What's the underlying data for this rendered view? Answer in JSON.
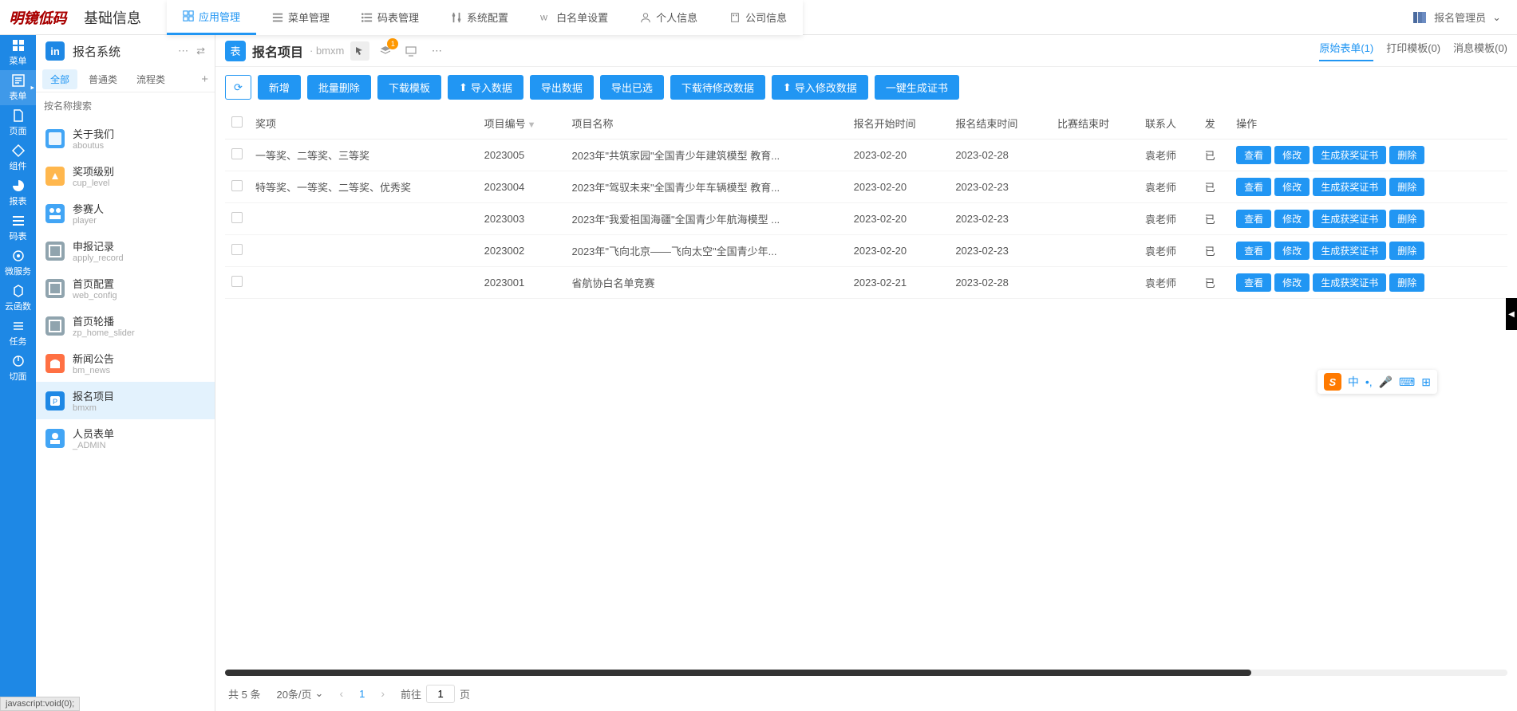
{
  "brand_logo": "明镜低码",
  "brand_title": "基础信息",
  "top_tabs": [
    {
      "label": "应用管理",
      "active": true
    },
    {
      "label": "菜单管理",
      "active": false
    },
    {
      "label": "码表管理",
      "active": false
    },
    {
      "label": "系统配置",
      "active": false
    },
    {
      "label": "白名单设置",
      "active": false
    },
    {
      "label": "个人信息",
      "active": false
    },
    {
      "label": "公司信息",
      "active": false
    }
  ],
  "user_name": "报名管理员",
  "rail": [
    {
      "label": "菜单"
    },
    {
      "label": "表单",
      "active": true
    },
    {
      "label": "页面"
    },
    {
      "label": "组件"
    },
    {
      "label": "报表"
    },
    {
      "label": "码表"
    },
    {
      "label": "微服务"
    },
    {
      "label": "云函数"
    },
    {
      "label": "任务"
    },
    {
      "label": "切面"
    }
  ],
  "app": {
    "badge": "in",
    "name": "报名系统"
  },
  "tree_tabs": [
    {
      "label": "全部",
      "active": true
    },
    {
      "label": "普通类"
    },
    {
      "label": "流程类"
    }
  ],
  "tree_search_placeholder": "按名称搜索",
  "tree_items": [
    {
      "title": "关于我们",
      "sub": "aboutus",
      "color": "#42a5f5"
    },
    {
      "title": "奖项级别",
      "sub": "cup_level",
      "color": "#ffb74d"
    },
    {
      "title": "参赛人",
      "sub": "player",
      "color": "#42a5f5"
    },
    {
      "title": "申报记录",
      "sub": "apply_record",
      "color": "#90a4ae"
    },
    {
      "title": "首页配置",
      "sub": "web_config",
      "color": "#90a4ae"
    },
    {
      "title": "首页轮播",
      "sub": "zp_home_slider",
      "color": "#90a4ae"
    },
    {
      "title": "新闻公告",
      "sub": "bm_news",
      "color": "#ff7043"
    },
    {
      "title": "报名项目",
      "sub": "bmxm",
      "color": "#1e88e5",
      "selected": true
    },
    {
      "title": "人员表单",
      "sub": "_ADMIN",
      "color": "#42a5f5"
    }
  ],
  "content_header": {
    "badge": "表",
    "title": "报名项目",
    "code": "· bmxm",
    "layer_badge": "1",
    "right_tabs": [
      {
        "label": "原始表单(1)",
        "active": true
      },
      {
        "label": "打印模板(0)"
      },
      {
        "label": "消息模板(0)"
      }
    ]
  },
  "toolbar": {
    "refresh": "↻",
    "create": "新增",
    "batch_delete": "批量删除",
    "download_tpl": "下载模板",
    "import": "导入数据",
    "export": "导出数据",
    "export_sel": "导出已选",
    "download_mod": "下载待修改数据",
    "import_mod": "导入修改数据",
    "gen_cert": "一键生成证书"
  },
  "columns": [
    "奖项",
    "项目编号",
    "项目名称",
    "报名开始时间",
    "报名结束时间",
    "比赛结束时",
    "联系人",
    "发",
    "操作"
  ],
  "row_buttons": {
    "view": "查看",
    "edit": "修改",
    "gen": "生成获奖证书",
    "del": "删除"
  },
  "rows": [
    {
      "award": "一等奖、二等奖、三等奖",
      "code": "2023005",
      "name": "2023年\"共筑家园\"全国青少年建筑模型 教育...",
      "start": "2023-02-20",
      "end": "2023-02-28",
      "contact": "袁老师",
      "pub": "已"
    },
    {
      "award": "特等奖、一等奖、二等奖、优秀奖",
      "code": "2023004",
      "name": "2023年\"驾驭未来\"全国青少年车辆模型 教育...",
      "start": "2023-02-20",
      "end": "2023-02-23",
      "contact": "袁老师",
      "pub": "已"
    },
    {
      "award": "",
      "code": "2023003",
      "name": "2023年\"我爱祖国海疆\"全国青少年航海模型 ...",
      "start": "2023-02-20",
      "end": "2023-02-23",
      "contact": "袁老师",
      "pub": "已"
    },
    {
      "award": "",
      "code": "2023002",
      "name": "2023年\"飞向北京——飞向太空\"全国青少年...",
      "start": "2023-02-20",
      "end": "2023-02-23",
      "contact": "袁老师",
      "pub": "已"
    },
    {
      "award": "",
      "code": "2023001",
      "name": "省航协白名单竞赛",
      "start": "2023-02-21",
      "end": "2023-02-28",
      "contact": "袁老师",
      "pub": "已"
    }
  ],
  "pagination": {
    "total_label": "共 5 条",
    "page_size": "20条/页",
    "current": "1",
    "goto_prefix": "前往",
    "goto_value": "1",
    "goto_suffix": "页"
  },
  "status_bar": "javascript:void(0);",
  "ime": {
    "logo": "S",
    "lang": "中"
  }
}
